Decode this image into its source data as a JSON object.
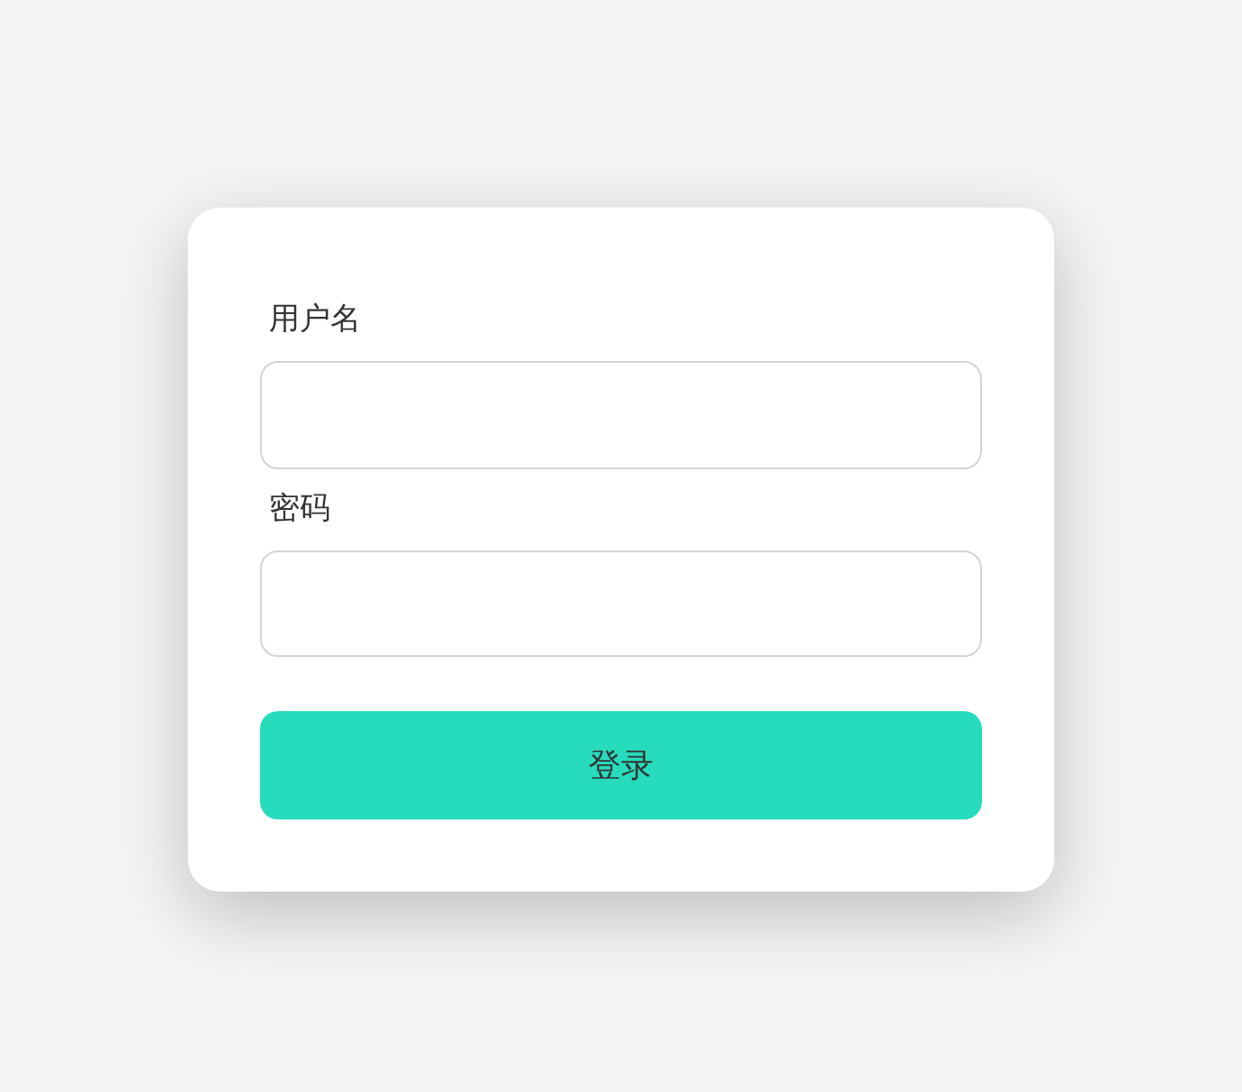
{
  "form": {
    "fields": [
      {
        "label": "用户名"
      },
      {
        "label": "密码"
      }
    ],
    "submit": "登录"
  }
}
